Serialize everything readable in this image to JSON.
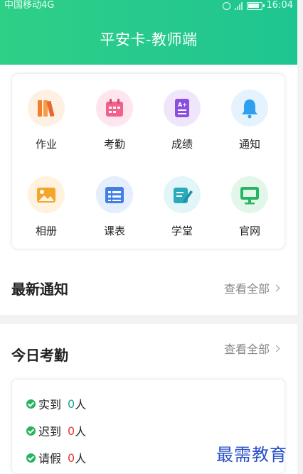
{
  "status_bar": {
    "carrier": "中国移动4G",
    "time": "16:04"
  },
  "header": {
    "title": "平安卡-教师端"
  },
  "grid": [
    {
      "label": "作业",
      "icon": "books-icon",
      "bg": "#fff0e4",
      "color": "#f07f2e"
    },
    {
      "label": "考勤",
      "icon": "calendar-icon",
      "bg": "#ffe6ee",
      "color": "#f2608c"
    },
    {
      "label": "成绩",
      "icon": "grade-icon",
      "bg": "#efe6fb",
      "color": "#8a4fe0"
    },
    {
      "label": "通知",
      "icon": "bell-icon",
      "bg": "#e4f3fd",
      "color": "#2f9ff0"
    },
    {
      "label": "相册",
      "icon": "image-icon",
      "bg": "#fff3df",
      "color": "#f4a52a"
    },
    {
      "label": "课表",
      "icon": "timetable-icon",
      "bg": "#e4eefc",
      "color": "#3f7fe6"
    },
    {
      "label": "学堂",
      "icon": "edit-icon",
      "bg": "#e2f5f8",
      "color": "#29aabd"
    },
    {
      "label": "官网",
      "icon": "monitor-icon",
      "bg": "#e3f6ea",
      "color": "#26b563"
    }
  ],
  "notices": {
    "title": "最新通知",
    "view_all": "查看全部"
  },
  "attendance": {
    "title": "今日考勤",
    "view_all": "查看全部",
    "rows": [
      {
        "label": "实到",
        "count": "0",
        "unit": "人",
        "count_color": "#1aa58a"
      },
      {
        "label": "迟到",
        "count": "0",
        "unit": "人",
        "count_color": "#e53935"
      },
      {
        "label": "请假",
        "count": "0",
        "unit": "人",
        "count_color": "#e53935"
      }
    ]
  },
  "watermark": "最需教育"
}
